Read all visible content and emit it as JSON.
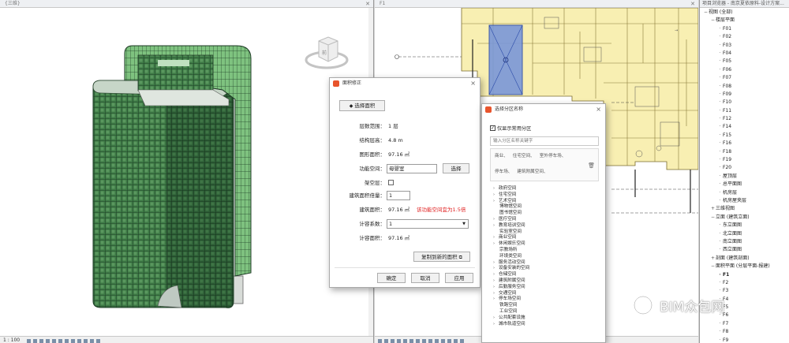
{
  "view3d": {
    "title": "{三维}",
    "scale": "1 : 100"
  },
  "plan": {
    "title": "F1"
  },
  "browser": {
    "title": "项目浏览器 - 南京夏依原料-设计方案...",
    "items": [
      {
        "label": "视图 (全部)",
        "level": 0,
        "twig": "−"
      },
      {
        "label": "楼层平面",
        "level": 1,
        "twig": "−"
      },
      {
        "label": "F01",
        "level": 2,
        "twig": ""
      },
      {
        "label": "F02",
        "level": 2,
        "twig": ""
      },
      {
        "label": "F03",
        "level": 2,
        "twig": ""
      },
      {
        "label": "F04",
        "level": 2,
        "twig": ""
      },
      {
        "label": "F05",
        "level": 2,
        "twig": ""
      },
      {
        "label": "F06",
        "level": 2,
        "twig": ""
      },
      {
        "label": "F07",
        "level": 2,
        "twig": ""
      },
      {
        "label": "F08",
        "level": 2,
        "twig": ""
      },
      {
        "label": "F09",
        "level": 2,
        "twig": ""
      },
      {
        "label": "F10",
        "level": 2,
        "twig": ""
      },
      {
        "label": "F11",
        "level": 2,
        "twig": ""
      },
      {
        "label": "F12",
        "level": 2,
        "twig": ""
      },
      {
        "label": "F14",
        "level": 2,
        "twig": ""
      },
      {
        "label": "F15",
        "level": 2,
        "twig": ""
      },
      {
        "label": "F16",
        "level": 2,
        "twig": ""
      },
      {
        "label": "F18",
        "level": 2,
        "twig": ""
      },
      {
        "label": "F19",
        "level": 2,
        "twig": ""
      },
      {
        "label": "F20",
        "level": 2,
        "twig": ""
      },
      {
        "label": "屋顶层",
        "level": 2,
        "twig": ""
      },
      {
        "label": "总平面图",
        "level": 2,
        "twig": ""
      },
      {
        "label": "机房层",
        "level": 2,
        "twig": ""
      },
      {
        "label": "机房屋夹层",
        "level": 2,
        "twig": ""
      },
      {
        "label": "三维视图",
        "level": 1,
        "twig": "+"
      },
      {
        "label": "立面 (建筑立面)",
        "level": 1,
        "twig": "−"
      },
      {
        "label": "东立面图",
        "level": 2,
        "twig": ""
      },
      {
        "label": "北立面图",
        "level": 2,
        "twig": ""
      },
      {
        "label": "南立面图",
        "level": 2,
        "twig": ""
      },
      {
        "label": "西立面图",
        "level": 2,
        "twig": ""
      },
      {
        "label": "剖面 (建筑剖面)",
        "level": 1,
        "twig": "+"
      },
      {
        "label": "面积平面 (分层平面-报建)",
        "level": 1,
        "twig": "−"
      },
      {
        "label": "F1",
        "level": 2,
        "twig": "",
        "sel": true
      },
      {
        "label": "F2",
        "level": 2,
        "twig": ""
      },
      {
        "label": "F3",
        "level": 2,
        "twig": ""
      },
      {
        "label": "F4",
        "level": 2,
        "twig": ""
      },
      {
        "label": "F5",
        "level": 2,
        "twig": ""
      },
      {
        "label": "F6",
        "level": 2,
        "twig": ""
      },
      {
        "label": "F7",
        "level": 2,
        "twig": ""
      },
      {
        "label": "F8",
        "level": 2,
        "twig": ""
      },
      {
        "label": "F9",
        "level": 2,
        "twig": ""
      }
    ]
  },
  "area_dialog": {
    "title": "面积修正",
    "select_area_button": "选择面积",
    "fields": {
      "floor_range_label": "层数范围：",
      "floor_range_value": "1 层",
      "struct_height_label": "结构层高：",
      "struct_height_value": "4.8 m",
      "drawing_area_label": "图形面积：",
      "drawing_area_value": "97.16 ㎡",
      "func_space_label": "功能空间：",
      "func_space_value": "母婴室",
      "select_button": "选择",
      "overhead_label": "架空层：",
      "multiplier_label": "建筑面积倍量：",
      "multiplier_value": "1",
      "building_area_label": "建筑面积：",
      "building_area_value": "97.16 ㎡",
      "warning": "该功能空间宜为1.5倍",
      "coef_label": "计容系数：",
      "coef_value": "1",
      "far_area_label": "计容面积：",
      "far_area_value": "97.16 ㎡"
    },
    "copy_button": "复制到新的面积",
    "ok": "确定",
    "cancel": "取消",
    "apply": "应用"
  },
  "zone_dialog": {
    "title": "选择分区名称",
    "only_common_label": "仅显示常用分区",
    "search_placeholder": "输入分区名称关键字",
    "tags_row1": [
      "商业、",
      "住宅空间、",
      "室外停车场、"
    ],
    "tags_row2": [
      "停车场、",
      "建筑附属空间、"
    ],
    "items": [
      {
        "label": "政府空间",
        "sub": false
      },
      {
        "label": "住宅空间",
        "sub": false
      },
      {
        "label": "艺术空间",
        "sub": false
      },
      {
        "label": "博物馆空间",
        "sub": true
      },
      {
        "label": "图书馆空间",
        "sub": true
      },
      {
        "label": "医疗空间",
        "sub": false
      },
      {
        "label": "教育培训空间",
        "sub": false
      },
      {
        "label": "实验室空间",
        "sub": true
      },
      {
        "label": "商业空间",
        "sub": false
      },
      {
        "label": "休闲娱乐空间",
        "sub": false
      },
      {
        "label": "宗教场所",
        "sub": true
      },
      {
        "label": "环境类空间",
        "sub": true
      },
      {
        "label": "服务活动空间",
        "sub": false
      },
      {
        "label": "设备安装的空间",
        "sub": false
      },
      {
        "label": "仓储空间",
        "sub": false
      },
      {
        "label": "建筑附属空间",
        "sub": false
      },
      {
        "label": "后勤服务空间",
        "sub": false
      },
      {
        "label": "交通空间",
        "sub": false
      },
      {
        "label": "停车场空间",
        "sub": false
      },
      {
        "label": "铁路空间",
        "sub": true
      },
      {
        "label": "工业空间",
        "sub": true
      },
      {
        "label": "公共配套设施",
        "sub": false
      },
      {
        "label": "城市轨道空间",
        "sub": false
      }
    ]
  },
  "watermark": {
    "text": "BIM众包网"
  }
}
